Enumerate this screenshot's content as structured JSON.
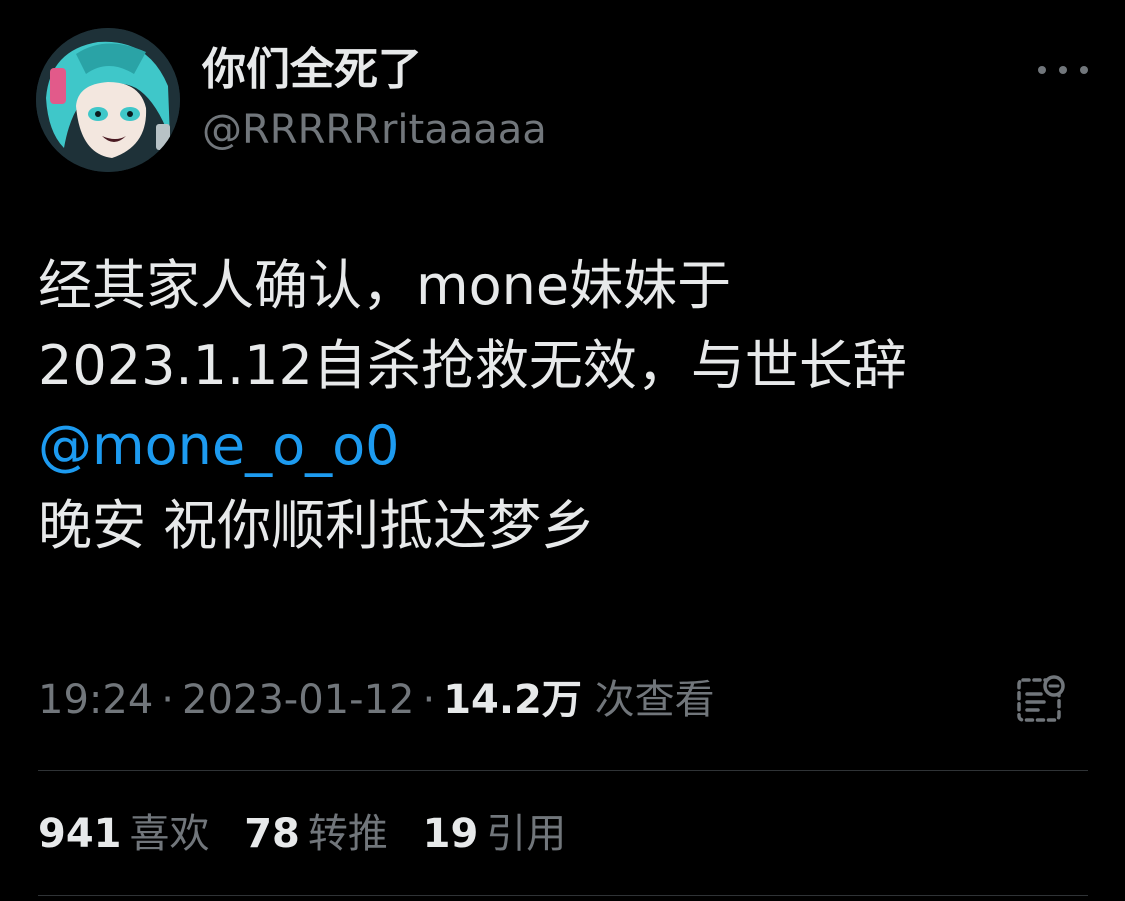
{
  "author": {
    "display_name": "你们全死了",
    "handle": "@RRRRRritaaaaa",
    "avatar_icon": "anime-avatar-icon"
  },
  "tweet": {
    "lines": [
      "经其家人确认，mone妹妹于",
      "2023.1.12自杀抢救无效，与世长辞"
    ],
    "mention": "@mone_o_o0",
    "last_line": "晚安 祝你顺利抵达梦乡"
  },
  "meta": {
    "time": "19:24",
    "separator": "·",
    "date": "2023-01-12",
    "views_count": "14.2万",
    "views_label": "次查看"
  },
  "stats": {
    "likes_count": "941",
    "likes_label": "喜欢",
    "retweets_count": "78",
    "retweets_label": "转推",
    "quotes_count": "19",
    "quotes_label": "引用"
  },
  "colors": {
    "background": "#000000",
    "text_primary": "#e7e9ea",
    "text_secondary": "#71767b",
    "link": "#1d9bf0",
    "divider": "#2f3336"
  }
}
